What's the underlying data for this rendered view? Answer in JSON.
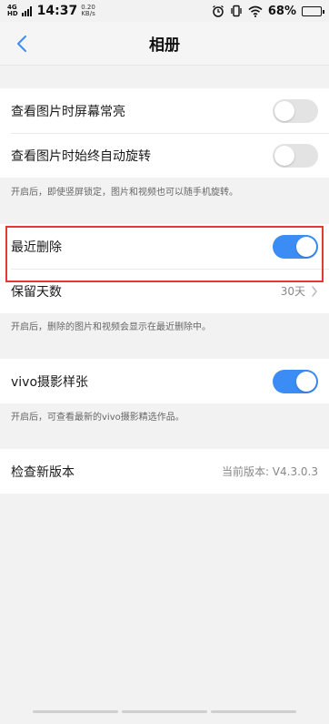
{
  "status_bar": {
    "network_top": "4G",
    "network_bottom": "HD",
    "time": "14:37",
    "speed_value": "0.20",
    "speed_unit": "KB/s",
    "battery": "68%",
    "battery_level_percent": 68
  },
  "nav": {
    "title": "相册"
  },
  "section1": {
    "items": [
      {
        "label": "查看图片时屏幕常亮",
        "toggle": "off"
      },
      {
        "label": "查看图片时始终自动旋转",
        "toggle": "off"
      }
    ],
    "note": "开启后，即使竖屏锁定，图片和视频也可以随手机旋转。"
  },
  "section2": {
    "recent_deleted_label": "最近删除",
    "recent_deleted_toggle": "on",
    "retention_label": "保留天数",
    "retention_value": "30天",
    "note": "开启后，删除的图片和视频会显示在最近删除中。"
  },
  "section3": {
    "label": "vivo摄影样张",
    "toggle": "on",
    "note": "开启后，可查看最新的vivo摄影精选作品。"
  },
  "section4": {
    "label": "检查新版本",
    "value": "当前版本: V4.3.0.3"
  },
  "colors": {
    "accent": "#3c8cf5",
    "highlight_border": "#e53935",
    "background": "#f2f2f2"
  }
}
